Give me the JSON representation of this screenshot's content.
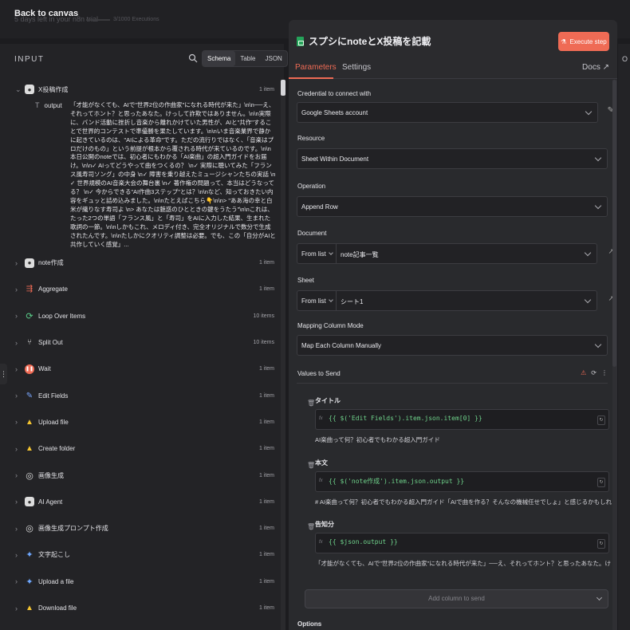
{
  "topbar": {
    "back_label": "Back to canvas",
    "trial_text": "5 days left in your n8n trial",
    "executions_text": "3/1000 Executions"
  },
  "input_panel": {
    "heading": "INPUT",
    "tabs": [
      "Schema",
      "Table",
      "JSON"
    ],
    "active_tab": "Schema",
    "first_node": {
      "name": "X投稿作成",
      "count": "1 item",
      "field_key": "output",
      "field_value": "「才能がなくても、AIで\"世界2位の作曲家\"になれる時代が来た」\\n\\n──え、それってホント？と思ったあなた。けっして詐欺ではありません。\\n\\n実際に、バンド活動に挫折し音楽から離れかけていた男性が、AIと\"共作\"することで世界的コンテストで準優勝を果たしています。\\n\\nいま音楽業界で静かに起きているのは、\"AIによる革命\"です。ただの流行りではなく、「音楽はプロだけのもの」という前提が根本から覆される時代が来ているのです。\\n\\n本日公開のnoteでは、初心者にもわかる「AI楽曲」の超入門ガイドをお届け。\\n\\n✓ AIってどうやって曲をつくるの？ \\n✓ 実際に聴いてみた「フランス風寿司ソング」の中身 \\n✓ 障害を乗り越えたミュージシャンたちの実話 \\n✓ 世界規模のAI音楽大会の舞台裏 \\n✓ 著作権の問題って、本当はどうなってる？ \\n✓ 今からできる\"AI作曲3ステップ\"とは？\\n\\nなど、知っておきたい内容をギュッと詰め込みました。\\n\\nたとえばこちら👇\\n\\n> \"ああ海の幸と白米が織りなす寿司よ \\n> あなたは魅惑のひとときの鍵をうたう\"\\n\\nこれは、たった2つの単語「フランス風」と「寿司」をAIに入力した結果、生まれた歌詞の一節。\\n\\nしかもこれ、メロディ付き、完全オリジナルで数分で生成されたんです。\\n\\nたしかにクオリティ調整は必要。でも、この「自分がAIと共作していく感覚」..."
    },
    "nodes": [
      {
        "name": "note作成",
        "count": "1 item",
        "icon": "brain-icon"
      },
      {
        "name": "Aggregate",
        "count": "1 item",
        "icon": "aggregate-icon"
      },
      {
        "name": "Loop Over Items",
        "count": "10 items",
        "icon": "loop-icon"
      },
      {
        "name": "Split Out",
        "count": "10 items",
        "icon": "split-icon"
      },
      {
        "name": "Wait",
        "count": "1 item",
        "icon": "pause-icon"
      },
      {
        "name": "Edit Fields",
        "count": "1 item",
        "icon": "pen-icon"
      },
      {
        "name": "Upload file",
        "count": "1 item",
        "icon": "drive-icon"
      },
      {
        "name": "Create folder",
        "count": "1 item",
        "icon": "drive-icon"
      },
      {
        "name": "画像生成",
        "count": "1 item",
        "icon": "openai-icon"
      },
      {
        "name": "AI Agent",
        "count": "1 item",
        "icon": "robot-icon"
      },
      {
        "name": "画像生成プロンプト作成",
        "count": "1 item",
        "icon": "openai-icon"
      },
      {
        "name": "文字起こし",
        "count": "1 item",
        "icon": "gemini-icon"
      },
      {
        "name": "Upload a file",
        "count": "1 item",
        "icon": "gemini-icon"
      },
      {
        "name": "Download file",
        "count": "1 item",
        "icon": "drive-icon"
      }
    ]
  },
  "node_panel": {
    "title": "スプシにnoteとX投稿を記載",
    "execute_label": "Execute step",
    "tabs": [
      "Parameters",
      "Settings"
    ],
    "docs_label": "Docs",
    "credential_label": "Credential to connect with",
    "credential_value": "Google Sheets account",
    "resource_label": "Resource",
    "resource_value": "Sheet Within Document",
    "operation_label": "Operation",
    "operation_value": "Append Row",
    "document_label": "Document",
    "document_mode": "From list",
    "document_value": "note記事一覧",
    "sheet_label": "Sheet",
    "sheet_mode": "From list",
    "sheet_value": "シート1",
    "mapping_label": "Mapping Column Mode",
    "mapping_value": "Map Each Column Manually",
    "values_label": "Values to Send",
    "columns": [
      {
        "name": "タイトル",
        "expression": "{{ $('Edit Fields').item.json.item[0] }}",
        "preview": "AI楽曲って何？初心者でもわかる超入門ガイド"
      },
      {
        "name": "本文",
        "expression": "{{ $('note作成').item.json.output }}",
        "preview": "# AI楽曲って何？初心者でもわかる超入門ガイド「AIで曲を作る？そんなの機械任せでしょ」と感じるかもしれません。でも..."
      },
      {
        "name": "告知分",
        "expression": "{{ $json.output }}",
        "preview": "「才能がなくても、AIで\"世界2位の作曲家\"になれる時代が来た」──え、それってホント？と思ったあなた。けっして詐欺で..."
      }
    ],
    "add_column_label": "Add column to send",
    "options_label": "Options"
  },
  "right_strip_letter": "O",
  "colors": {
    "accent": "#ef6b55",
    "code": "#6fd38b",
    "sheets": "#25a35a"
  }
}
